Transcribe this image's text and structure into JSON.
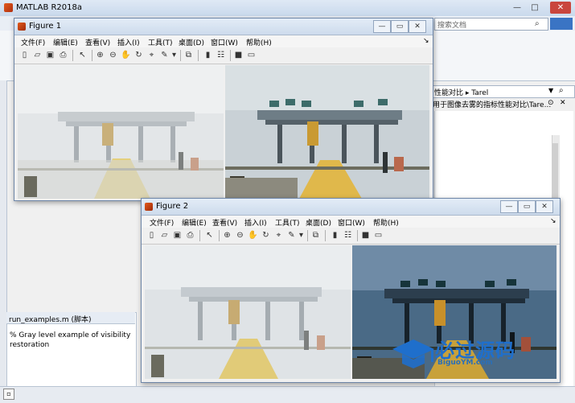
{
  "app": {
    "title": "MATLAB R2018a"
  },
  "search": {
    "placeholder": "搜索文档"
  },
  "address": {
    "path": "性能对比 ▸ Tarel",
    "subpath": "用于图像去雾的指标性能对比\\Tare..."
  },
  "script": {
    "tab": "run_examples.m  (脚本)",
    "comment": "% Gray level example of visibility restoration"
  },
  "figures": [
    {
      "title": "Figure 1",
      "menu": [
        "文件(F)",
        "编辑(E)",
        "查看(V)",
        "插入(I)",
        "工具(T)",
        "桌面(D)",
        "窗口(W)",
        "帮助(H)"
      ]
    },
    {
      "title": "Figure 2",
      "menu": [
        "文件(F)",
        "编辑(E)",
        "查看(V)",
        "插入(I)",
        "工具(T)",
        "桌面(D)",
        "窗口(W)",
        "帮助(H)"
      ]
    }
  ],
  "icons": {
    "toolbar": [
      "new-figure-icon",
      "open-file-icon",
      "save-icon",
      "print-icon",
      "pointer-icon",
      "zoom-in-icon",
      "zoom-out-icon",
      "pan-icon",
      "rotate-icon",
      "data-cursor-icon",
      "brush-icon",
      "link-plot-icon",
      "colorbar-icon",
      "legend-icon",
      "hide-plot-tools-icon",
      "show-plot-tools-icon"
    ]
  },
  "watermark": {
    "text": "必过源码",
    "url": "BiguoYM.com"
  },
  "colors": {
    "accent": "#3a74c4",
    "close": "#c9463d"
  }
}
